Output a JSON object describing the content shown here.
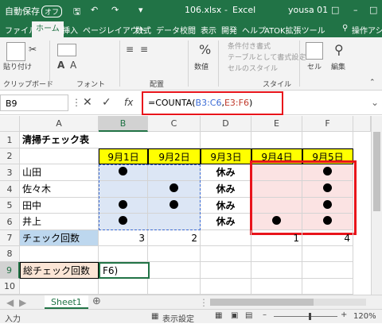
{
  "title_bar": {
    "autosave": "自動保存",
    "autosave_state": "オフ",
    "filename": "106.xlsx",
    "app": "Excel",
    "user": "yousa 01",
    "accent_color": "#217346"
  },
  "ribbon_tabs": [
    "ファイル",
    "ホーム",
    "挿入",
    "ページレイアウト",
    "数式",
    "データ",
    "校閲",
    "表示",
    "開発",
    "ヘルプ",
    "ATOK拡張ツール"
  ],
  "active_tab": "ホーム",
  "ribbon_help": "操作アシ",
  "ribbon": {
    "paste_label": "貼り付け",
    "clipboard_group": "クリップボード",
    "font_group": "フォント",
    "alignment_group": "配置",
    "number_label": "数値",
    "number_symbol": "%",
    "styles": [
      "条件付き書式",
      "テーブルとして書式設定",
      "セルのスタイル"
    ],
    "styles_group": "スタイル",
    "cells_label": "セル",
    "editing_label": "編集"
  },
  "formula_bar": {
    "name_box": "B9",
    "fx": "fx",
    "formula_parts": [
      {
        "text": "=COUNTA(",
        "color": "#000000"
      },
      {
        "text": "B3:C6",
        "color": "#3b6bd6"
      },
      {
        "text": ",",
        "color": "#000000"
      },
      {
        "text": "E3:F6",
        "color": "#c0392b"
      },
      {
        "text": ")",
        "color": "#000000"
      }
    ]
  },
  "grid": {
    "columns": [
      "A",
      "B",
      "C",
      "D",
      "E",
      "F"
    ],
    "rows": [
      "1",
      "2",
      "3",
      "4",
      "5",
      "6",
      "7",
      "8",
      "9",
      "10"
    ],
    "title": "清掃チェック表",
    "dates": [
      "9月1日",
      "9月2日",
      "9月3日",
      "9月4日",
      "9月5日"
    ],
    "names": [
      "山田",
      "佐々木",
      "田中",
      "井上"
    ],
    "marks": [
      [
        "●",
        "",
        "休み",
        "",
        "●"
      ],
      [
        "",
        "●",
        "休み",
        "",
        "●"
      ],
      [
        "●",
        "●",
        "休み",
        "",
        "●"
      ],
      [
        "●",
        "",
        "休み",
        "●",
        "●"
      ]
    ],
    "count_label": "チェック回数",
    "counts": [
      "3",
      "2",
      "",
      "1",
      "4"
    ],
    "total_label": "総チェック回数",
    "editing_cell_text": "F6)"
  },
  "sheet_tabs": [
    "Sheet1"
  ],
  "status_bar": {
    "mode": "入力",
    "display_settings": "表示設定",
    "zoom": "120%"
  }
}
